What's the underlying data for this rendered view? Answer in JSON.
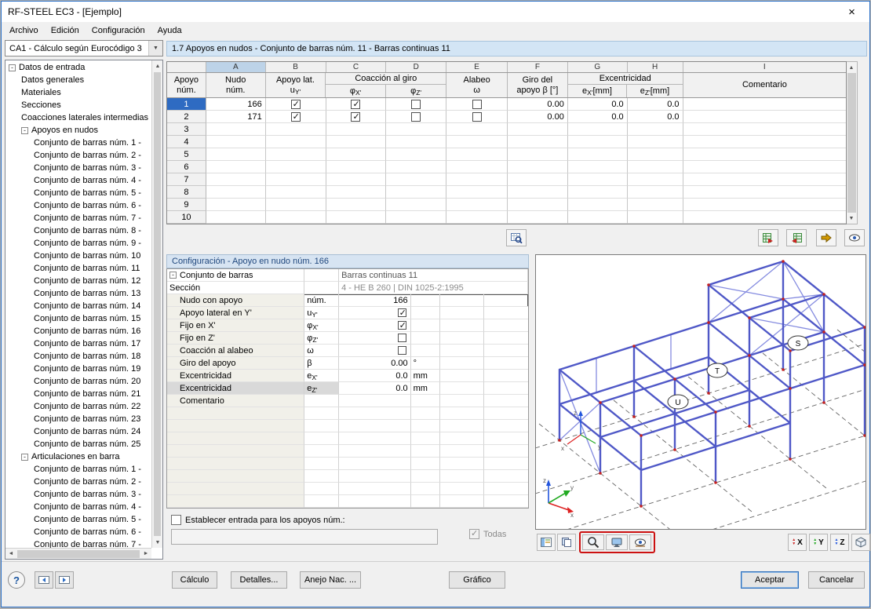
{
  "window": {
    "title": "RF-STEEL EC3 - [Ejemplo]",
    "close": "×"
  },
  "menu": {
    "items": [
      "Archivo",
      "Edición",
      "Configuración",
      "Ayuda"
    ]
  },
  "sidebar": {
    "case_selector": "CA1 - Cálculo según Eurocódigo 3",
    "tree": [
      {
        "label": "Datos de entrada",
        "cls": "lvl0",
        "expc": "exp"
      },
      {
        "label": "Datos generales",
        "cls": "lvl1"
      },
      {
        "label": "Materiales",
        "cls": "lvl1"
      },
      {
        "label": "Secciones",
        "cls": "lvl1"
      },
      {
        "label": "Coacciones laterales intermedias",
        "cls": "lvl1"
      },
      {
        "label": "Apoyos en nudos",
        "cls": "lvl1",
        "expc": "exp"
      },
      {
        "label": "Conjunto de barras núm. 1 -",
        "cls": "lvl2"
      },
      {
        "label": "Conjunto de barras núm. 2 -",
        "cls": "lvl2"
      },
      {
        "label": "Conjunto de barras núm. 3 -",
        "cls": "lvl2"
      },
      {
        "label": "Conjunto de barras núm. 4 -",
        "cls": "lvl2"
      },
      {
        "label": "Conjunto de barras núm. 5 -",
        "cls": "lvl2"
      },
      {
        "label": "Conjunto de barras núm. 6 -",
        "cls": "lvl2"
      },
      {
        "label": "Conjunto de barras núm. 7 -",
        "cls": "lvl2"
      },
      {
        "label": "Conjunto de barras núm. 8 -",
        "cls": "lvl2"
      },
      {
        "label": "Conjunto de barras núm. 9 -",
        "cls": "lvl2"
      },
      {
        "label": "Conjunto de barras núm. 10",
        "cls": "lvl2"
      },
      {
        "label": "Conjunto de barras núm. 11",
        "cls": "lvl2"
      },
      {
        "label": "Conjunto de barras núm. 12",
        "cls": "lvl2"
      },
      {
        "label": "Conjunto de barras núm. 13",
        "cls": "lvl2"
      },
      {
        "label": "Conjunto de barras núm. 14",
        "cls": "lvl2"
      },
      {
        "label": "Conjunto de barras núm. 15",
        "cls": "lvl2"
      },
      {
        "label": "Conjunto de barras núm. 16",
        "cls": "lvl2"
      },
      {
        "label": "Conjunto de barras núm. 17",
        "cls": "lvl2"
      },
      {
        "label": "Conjunto de barras núm. 18",
        "cls": "lvl2"
      },
      {
        "label": "Conjunto de barras núm. 19",
        "cls": "lvl2"
      },
      {
        "label": "Conjunto de barras núm. 20",
        "cls": "lvl2"
      },
      {
        "label": "Conjunto de barras núm. 21",
        "cls": "lvl2"
      },
      {
        "label": "Conjunto de barras núm. 22",
        "cls": "lvl2"
      },
      {
        "label": "Conjunto de barras núm. 23",
        "cls": "lvl2"
      },
      {
        "label": "Conjunto de barras núm. 24",
        "cls": "lvl2"
      },
      {
        "label": "Conjunto de barras núm. 25",
        "cls": "lvl2"
      },
      {
        "label": "Articulaciones en barra",
        "cls": "lvl1",
        "expc": "exp"
      },
      {
        "label": "Conjunto de barras núm. 1 -",
        "cls": "lvl2"
      },
      {
        "label": "Conjunto de barras núm. 2 -",
        "cls": "lvl2"
      },
      {
        "label": "Conjunto de barras núm. 3 -",
        "cls": "lvl2"
      },
      {
        "label": "Conjunto de barras núm. 4 -",
        "cls": "lvl2"
      },
      {
        "label": "Conjunto de barras núm. 5 -",
        "cls": "lvl2"
      },
      {
        "label": "Conjunto de barras núm. 6 -",
        "cls": "lvl2"
      },
      {
        "label": "Conjunto de barras núm. 7 -",
        "cls": "lvl2"
      }
    ]
  },
  "main": {
    "section_title": "1.7 Apoyos en nudos - Conjunto de barras núm. 11 - Barras continuas 11",
    "table": {
      "letters": [
        "A",
        "B",
        "C",
        "D",
        "E",
        "F",
        "G",
        "H",
        "I"
      ],
      "h": {
        "corner1": "Apoyo",
        "corner2": "núm.",
        "a1": "Nudo",
        "a2": "núm.",
        "b1": "Apoyo lat.",
        "b2a": "u",
        "b2b": "Y'",
        "cd": "Coacción al giro",
        "c2a": "φ",
        "c2b": "X'",
        "d2a": "φ",
        "d2b": "Z'",
        "e1": "Alabeo",
        "e2": "ω",
        "f1": "Giro del",
        "f2": "apoyo β [°]",
        "gh": "Excentricidad",
        "g2a": "e",
        "g2b": "X'",
        "g2c": " [mm]",
        "h2a": "e",
        "h2b": "Z'",
        "h2c": " [mm]",
        "i": "Comentario"
      },
      "rows": [
        {
          "num": "1",
          "numcls": "sel",
          "nudo": "166",
          "uy": "cb-on",
          "px": "cb-on",
          "pz": "cb-off",
          "om": "cb-off",
          "giro": "0.00",
          "ex": "0.0",
          "ez": "0.0",
          "comment": ""
        },
        {
          "num": "2",
          "nudo": "171",
          "uy": "cb-on",
          "px": "cb-on",
          "pz": "cb-off",
          "om": "cb-off",
          "giro": "0.00",
          "ex": "0.0",
          "ez": "0.0",
          "comment": ""
        },
        {
          "num": "3"
        },
        {
          "num": "4"
        },
        {
          "num": "5"
        },
        {
          "num": "6"
        },
        {
          "num": "7"
        },
        {
          "num": "8"
        },
        {
          "num": "9"
        },
        {
          "num": "10"
        }
      ]
    },
    "config": {
      "title": "Configuración - Apoyo en nudo núm. 166",
      "rows": [
        {
          "rcls": "top",
          "expc": "exp",
          "label": "Conjunto de barras",
          "val": "Barras continuas 11",
          "vcls": "ro1"
        },
        {
          "rcls": "top ind",
          "label": "Sección",
          "val": "4 - HE B 260 | DIN 1025-2:1995",
          "vcls": "ro2"
        },
        {
          "rcls": "ind focus",
          "label": "Nudo con apoyo",
          "sym": "núm.",
          "val": "166",
          "vcls": "num"
        },
        {
          "rcls": "ind",
          "label": "Apoyo lateral en Y'",
          "sym": "u",
          "sub": "Y'",
          "cb": "cb-on"
        },
        {
          "rcls": "ind",
          "label": "Fijo en X'",
          "sym": "φ",
          "sub": "X'",
          "cb": "cb-on"
        },
        {
          "rcls": "ind",
          "label": "Fijo en Z'",
          "sym": "φ",
          "sub": "Z'",
          "cb": "cb-off"
        },
        {
          "rcls": "ind",
          "label": "Coacción al alabeo",
          "sym": "ω",
          "cb": "cb-off"
        },
        {
          "rcls": "ind",
          "label": "Giro del apoyo",
          "sym": "β",
          "val": "0.00",
          "vcls": "num",
          "unit": "°"
        },
        {
          "rcls": "ind",
          "label": "Excentricidad",
          "sym": "e",
          "sub": "X'",
          "val": "0.0",
          "vcls": "num",
          "unit": "mm"
        },
        {
          "rcls": "ind shade",
          "label": "Excentricidad",
          "sym": "e",
          "sub": "Z'",
          "val": "0.0",
          "vcls": "num",
          "unit": "mm"
        },
        {
          "rcls": "ind",
          "label": "Comentario"
        },
        {},
        {},
        {},
        {},
        {},
        {},
        {},
        {}
      ],
      "apply_label": "Establecer entrada para los apoyos núm.:",
      "apply_value": "",
      "todas_label": "Todas"
    }
  },
  "viewport": {
    "node_labels": [
      "S",
      "T",
      "U"
    ],
    "axes": {
      "x": "x",
      "y": "y",
      "z": "z"
    },
    "view_buttons": [
      "X",
      "Y",
      "Z"
    ]
  },
  "footer": {
    "help": "?",
    "calculo": "Cálculo",
    "detalles": "Detalles...",
    "anejo": "Anejo Nac. ...",
    "grafico": "Gráfico",
    "aceptar": "Aceptar",
    "cancelar": "Cancelar"
  }
}
